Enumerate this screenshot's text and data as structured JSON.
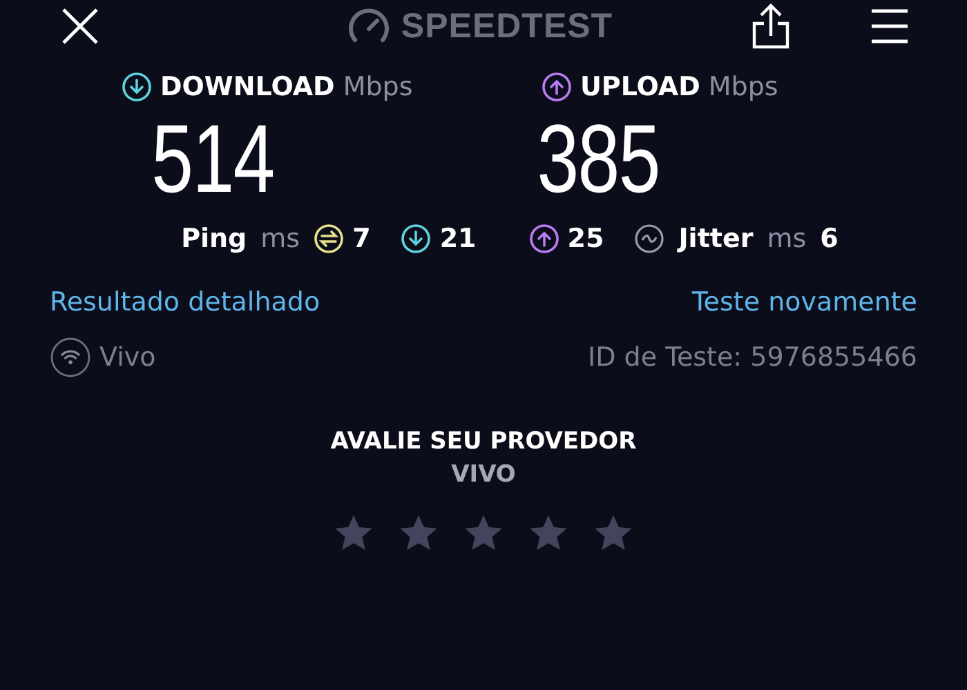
{
  "header": {
    "logo": "SPEEDTEST"
  },
  "results": [
    {
      "kind": "download",
      "label": "DOWNLOAD",
      "unit": "Mbps",
      "value": "514"
    },
    {
      "kind": "upload",
      "label": "UPLOAD",
      "unit": "Mbps",
      "value": "385"
    }
  ],
  "ping": {
    "label": "Ping",
    "unit": "ms",
    "values": [
      {
        "kind": "idle",
        "value": "7"
      },
      {
        "kind": "download",
        "value": "21"
      },
      {
        "kind": "upload",
        "value": "25"
      }
    ]
  },
  "jitter": {
    "label": "Jitter",
    "unit": "ms",
    "value": "6"
  },
  "links": [
    "Resultado detalhado",
    "Teste novamente"
  ],
  "provider": "Vivo",
  "test_id": "ID de Teste: 5976855466",
  "rating": {
    "title": "AVALIE SEU PROVEDOR",
    "provider": "VIVO"
  }
}
